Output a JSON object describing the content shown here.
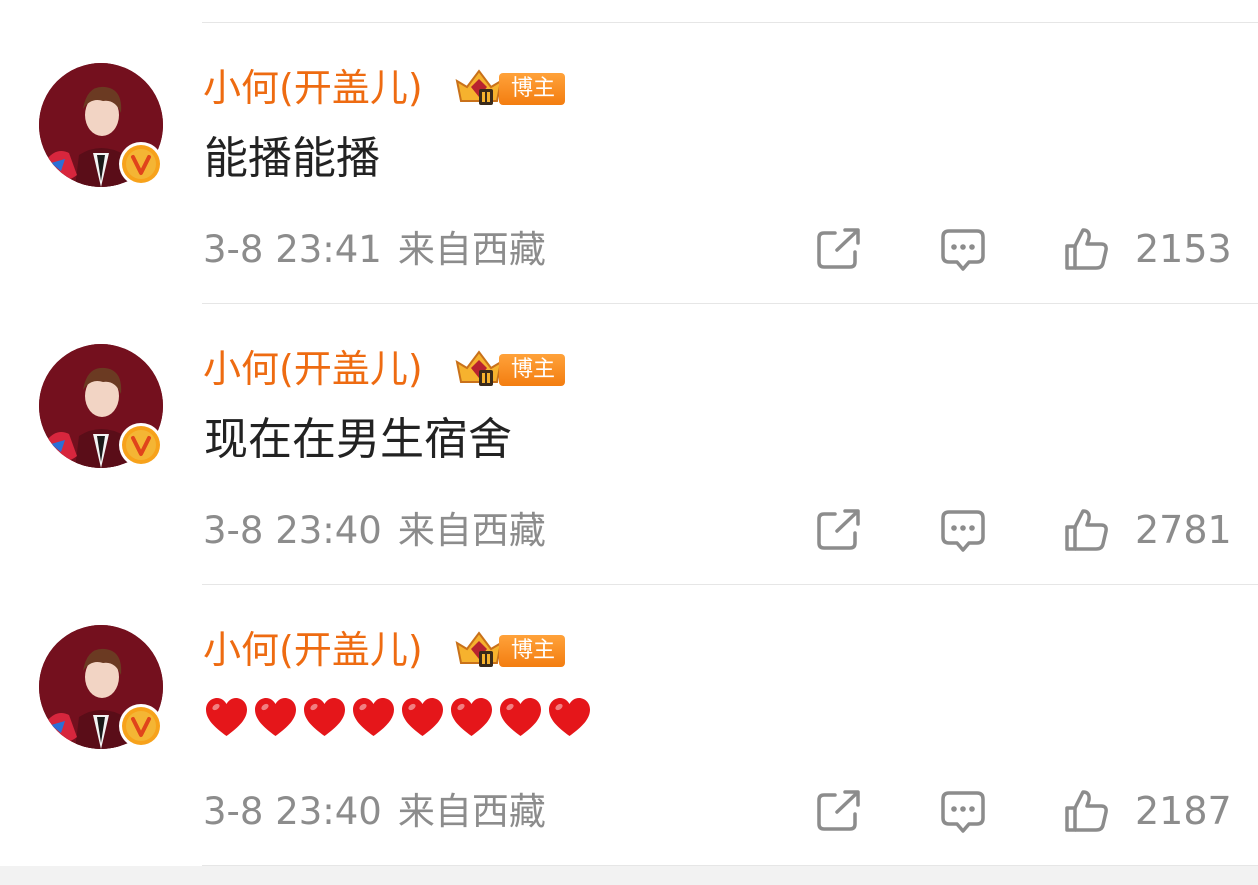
{
  "comments": [
    {
      "username": "小何(开盖儿)",
      "badge_label": "博主",
      "content": "能播能播",
      "time": "3-8 23:41",
      "location": "来自西藏",
      "like_count": "2153"
    },
    {
      "username": "小何(开盖儿)",
      "badge_label": "博主",
      "content": "现在在男生宿舍",
      "time": "3-8 23:40",
      "location": "来自西藏",
      "like_count": "2781"
    },
    {
      "username": "小何(开盖儿)",
      "badge_label": "博主",
      "content": "",
      "content_emoji": "red-heart-icon",
      "content_emoji_count": 8,
      "time": "3-8 23:40",
      "location": "来自西藏",
      "like_count": "2187"
    }
  ],
  "colors": {
    "username": "#ee6b11",
    "meta": "#8c8c8c",
    "badge": "#f37d10",
    "heart": "#e5161a",
    "verified": "#f7a21b"
  },
  "icons": {
    "share": "share-icon",
    "reply": "comment-icon",
    "like": "thumbs-up-icon",
    "verified": "verified-v-icon",
    "crown": "crown-badge-icon"
  }
}
